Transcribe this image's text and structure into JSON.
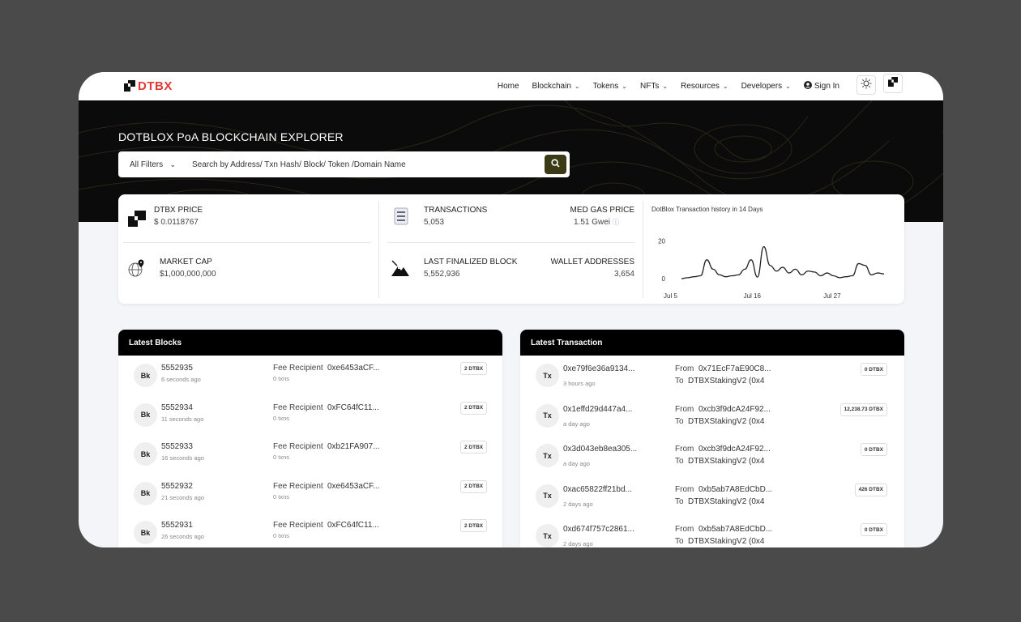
{
  "brand": {
    "name": "DTBX"
  },
  "nav": {
    "items": [
      {
        "label": "Home",
        "dropdown": false
      },
      {
        "label": "Blockchain",
        "dropdown": true
      },
      {
        "label": "Tokens",
        "dropdown": true
      },
      {
        "label": "NFTs",
        "dropdown": true
      },
      {
        "label": "Resources",
        "dropdown": true
      },
      {
        "label": "Developers",
        "dropdown": true
      }
    ],
    "signin": "Sign In"
  },
  "hero": {
    "title": "DOTBLOX PoA BLOCKCHAIN EXPLORER",
    "filter_label": "All Filters",
    "search_placeholder": "Search by Address/ Txn Hash/ Block/ Token /Domain Name"
  },
  "stats": {
    "price": {
      "label": "DTBX PRICE",
      "value": "$ 0.0118767"
    },
    "market_cap": {
      "label": "MARKET CAP",
      "value": "$1,000,000,000"
    },
    "transactions": {
      "label": "TRANSACTIONS",
      "value": "5,053"
    },
    "gas": {
      "label": "MED GAS PRICE",
      "value": "1.51 Gwei"
    },
    "finalized": {
      "label": "LAST FINALIZED BLOCK",
      "value": "5,552,936"
    },
    "wallets": {
      "label": "WALLET ADDRESSES",
      "value": "3,654"
    }
  },
  "chart_data": {
    "type": "line",
    "title": "DotBlox Transaction history in 14 Days",
    "x_ticks": [
      "Jul 5",
      "Jul 16",
      "Jul 27"
    ],
    "y_ticks": [
      "0",
      "20"
    ],
    "values": [
      0,
      0.5,
      1,
      1.5,
      10,
      5,
      2,
      1,
      1.5,
      2,
      5,
      10,
      0.8,
      17,
      7,
      4,
      6,
      3,
      5,
      2,
      4,
      3.5,
      1.5,
      3,
      1.5,
      0.5,
      1,
      1.5,
      8,
      7,
      2,
      3,
      2.5
    ],
    "ylim": [
      0,
      25
    ]
  },
  "latest_blocks": {
    "title": "Latest Blocks",
    "badge": "Bk",
    "rows": [
      {
        "number": "5552935",
        "age": "6 seconds ago",
        "recipient_label": "Fee Recipient",
        "recipient": "0xe6453aCF...",
        "txns": "0 txns",
        "reward": "2 DTBX"
      },
      {
        "number": "5552934",
        "age": "11 seconds ago",
        "recipient_label": "Fee Recipient",
        "recipient": "0xFC64fC11...",
        "txns": "0 txns",
        "reward": "2 DTBX"
      },
      {
        "number": "5552933",
        "age": "16 seconds ago",
        "recipient_label": "Fee Recipient",
        "recipient": "0xb21FA907...",
        "txns": "0 txns",
        "reward": "2 DTBX"
      },
      {
        "number": "5552932",
        "age": "21 seconds ago",
        "recipient_label": "Fee Recipient",
        "recipient": "0xe6453aCF...",
        "txns": "0 txns",
        "reward": "2 DTBX"
      },
      {
        "number": "5552931",
        "age": "26 seconds ago",
        "recipient_label": "Fee Recipient",
        "recipient": "0xFC64fC11...",
        "txns": "0 txns",
        "reward": "2 DTBX"
      }
    ]
  },
  "latest_transactions": {
    "title": "Latest Transaction",
    "badge": "Tx",
    "rows": [
      {
        "hash": "0xe79f6e36a9134...",
        "age": "3 hours ago",
        "from_label": "From",
        "from": "0x71EcF7aE90C8...",
        "to_label": "To",
        "to": "DTBXStakingV2 (0x4",
        "amount": "0 DTBX"
      },
      {
        "hash": "0x1effd29d447a4...",
        "age": "a day ago",
        "from_label": "From",
        "from": "0xcb3f9dcA24F92...",
        "to_label": "To",
        "to": "DTBXStakingV2 (0x4",
        "amount": "12,238.73 DTBX"
      },
      {
        "hash": "0x3d043eb8ea305...",
        "age": "a day ago",
        "from_label": "From",
        "from": "0xcb3f9dcA24F92...",
        "to_label": "To",
        "to": "DTBXStakingV2 (0x4",
        "amount": "0 DTBX"
      },
      {
        "hash": "0xac65822ff21bd...",
        "age": "2 days ago",
        "from_label": "From",
        "from": "0xb5ab7A8EdCbD...",
        "to_label": "To",
        "to": "DTBXStakingV2 (0x4",
        "amount": "426 DTBX"
      },
      {
        "hash": "0xd674f757c2861...",
        "age": "2 days ago",
        "from_label": "From",
        "from": "0xb5ab7A8EdCbD...",
        "to_label": "To",
        "to": "DTBXStakingV2 (0x4",
        "amount": "0 DTBX"
      }
    ]
  }
}
